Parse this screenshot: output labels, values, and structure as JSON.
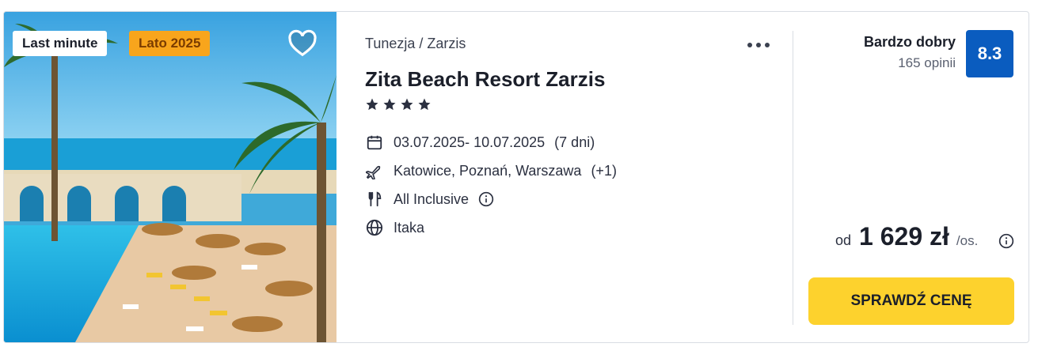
{
  "badges": {
    "last_minute": "Last minute",
    "season": "Lato 2025"
  },
  "favorite_icon": "heart-outline-icon",
  "hotel": {
    "location": "Tunezja / Zarzis",
    "name": "Zita Beach Resort Zarzis",
    "stars": 4,
    "more_icon": "more-horizontal-icon"
  },
  "details": {
    "dates": "03.07.2025- 10.07.2025",
    "duration": "(7 dni)",
    "departures": "Katowice, Poznań, Warszawa",
    "departures_extra": "(+1)",
    "board": "All Inclusive",
    "operator": "Itaka"
  },
  "rating": {
    "label": "Bardzo dobry",
    "count": "165 opinii",
    "score": "8.3"
  },
  "price": {
    "prefix": "od",
    "value": "1 629 zł",
    "suffix": "/os."
  },
  "cta": {
    "label": "SPRAWDŹ CENĘ"
  },
  "colors": {
    "score_bg": "#0a5cbf",
    "cta_bg": "#fdd22d",
    "season_badge": "#f8a51c"
  }
}
